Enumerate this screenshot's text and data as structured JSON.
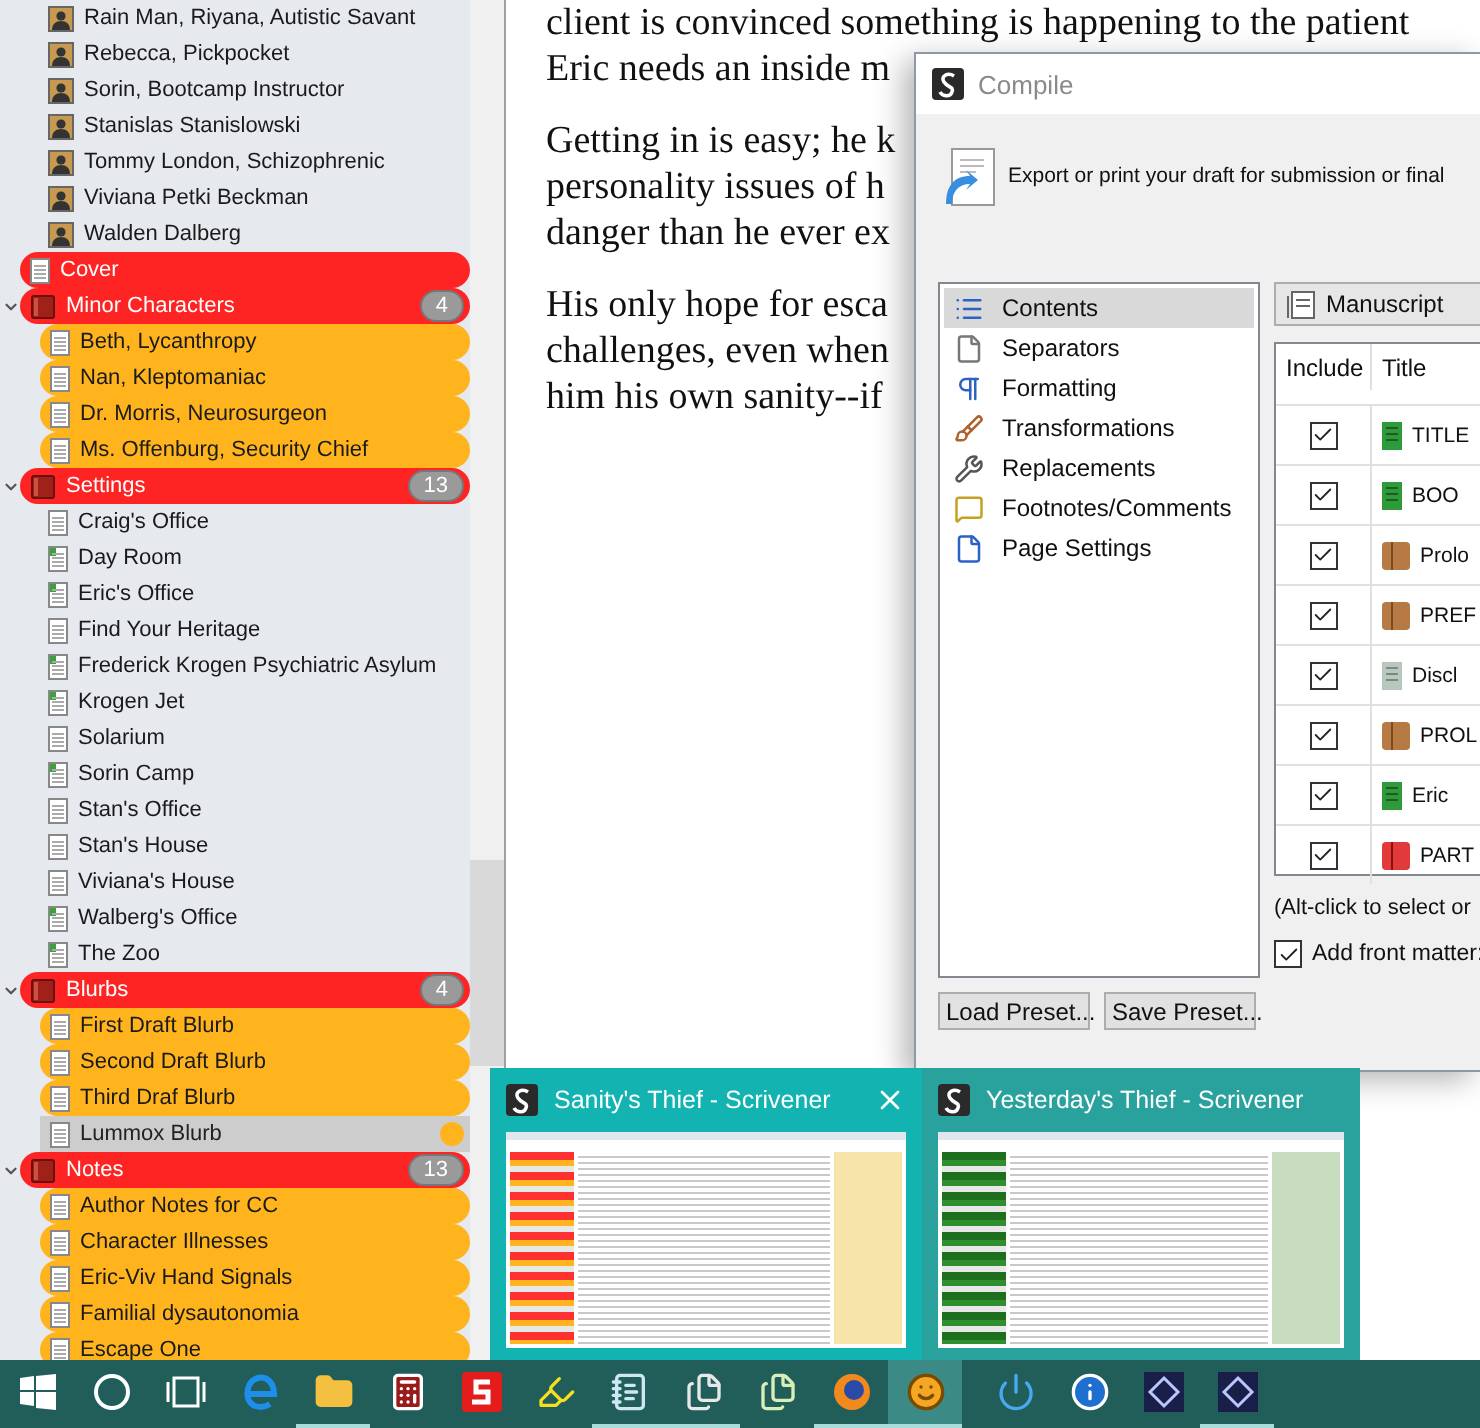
{
  "binder": {
    "continued_children": [
      {
        "label": "Rain Man, Riyana, Autistic Savant",
        "kind": "character",
        "selected": false
      },
      {
        "label": "Rebecca, Pickpocket",
        "kind": "character",
        "selected": false
      },
      {
        "label": "Sorin, Bootcamp Instructor",
        "kind": "character",
        "selected": false
      },
      {
        "label": "Stanislas Stanislowski",
        "kind": "character",
        "selected": false
      },
      {
        "label": "Tommy London, Schizophrenic",
        "kind": "character",
        "selected": false
      },
      {
        "label": "Viviana Petki Beckman",
        "kind": "character",
        "selected": false
      },
      {
        "label": "Walden Dalberg",
        "kind": "character",
        "selected": false
      }
    ],
    "items": [
      {
        "label": "Cover",
        "kind": "document",
        "color": "#ff2424",
        "selected": false
      },
      {
        "label": "Minor Characters",
        "kind": "folder",
        "color": "#ff2424",
        "expanded": true,
        "count": "4",
        "selected": false,
        "children": [
          {
            "label": "Beth, Lycanthropy",
            "kind": "document",
            "color": "#ffb41e",
            "selected": false
          },
          {
            "label": "Nan, Kleptomaniac",
            "kind": "document",
            "color": "#ffb41e",
            "selected": false
          },
          {
            "label": "Dr. Morris, Neurosurgeon",
            "kind": "document",
            "color": "#ffb41e",
            "selected": false
          },
          {
            "label": "Ms. Offenburg, Security Chief",
            "kind": "document",
            "color": "#ffb41e",
            "selected": false
          }
        ]
      },
      {
        "label": "Settings",
        "kind": "folder",
        "color": "#ff2424",
        "expanded": true,
        "count": "13",
        "selected": false,
        "children": [
          {
            "label": "Craig's Office",
            "kind": "document",
            "selected": false
          },
          {
            "label": "Day Room",
            "kind": "scene",
            "selected": false
          },
          {
            "label": "Eric's Office",
            "kind": "scene",
            "selected": false
          },
          {
            "label": "Find Your Heritage",
            "kind": "document",
            "selected": false
          },
          {
            "label": "Frederick Krogen Psychiatric Asylum",
            "kind": "scene",
            "selected": false
          },
          {
            "label": "Krogen Jet",
            "kind": "scene",
            "selected": false
          },
          {
            "label": "Solarium",
            "kind": "document",
            "selected": false
          },
          {
            "label": "Sorin Camp",
            "kind": "scene",
            "selected": false
          },
          {
            "label": "Stan's Office",
            "kind": "document",
            "selected": false
          },
          {
            "label": "Stan's House",
            "kind": "document",
            "selected": false
          },
          {
            "label": "Viviana's House",
            "kind": "document",
            "selected": false
          },
          {
            "label": "Walberg's Office",
            "kind": "scene",
            "selected": false
          },
          {
            "label": "The Zoo",
            "kind": "scene",
            "selected": false
          }
        ]
      },
      {
        "label": "Blurbs",
        "kind": "folder",
        "color": "#ff2424",
        "expanded": true,
        "count": "4",
        "selected": false,
        "children": [
          {
            "label": "First Draft Blurb",
            "kind": "document",
            "color": "#ffb41e",
            "selected": false
          },
          {
            "label": "Second Draft Blurb",
            "kind": "document",
            "color": "#ffb41e",
            "selected": false
          },
          {
            "label": "Third Draf Blurb",
            "kind": "document",
            "color": "#ffb41e",
            "selected": false
          },
          {
            "label": "Lummox Blurb",
            "kind": "document",
            "color": "#ffb41e",
            "selected": true
          }
        ]
      },
      {
        "label": "Notes",
        "kind": "folder",
        "color": "#ff2424",
        "expanded": true,
        "count": "13",
        "selected": false,
        "children": [
          {
            "label": "Author Notes for CC",
            "kind": "document",
            "color": "#ffb41e",
            "selected": false
          },
          {
            "label": "Character Illnesses",
            "kind": "document",
            "color": "#ffb41e",
            "selected": false
          },
          {
            "label": "Eric-Viv Hand Signals",
            "kind": "document",
            "color": "#ffb41e",
            "selected": false
          },
          {
            "label": "Familial dysautonomia",
            "kind": "document",
            "color": "#ffb41e",
            "selected": false
          },
          {
            "label": "Escape One",
            "kind": "document",
            "color": "#ffb41e",
            "selected": false
          }
        ]
      }
    ]
  },
  "editor": {
    "paragraphs": [
      [
        "client is convinced something is happening to the patient",
        "Eric needs an inside m"
      ],
      [
        "Getting in is easy; he k",
        "personality issues of h",
        "danger than he ever ex"
      ],
      [
        "His only hope for esca",
        "challenges, even when",
        "him his own sanity--if"
      ]
    ]
  },
  "compile": {
    "title": "Compile",
    "intro": "Export or print your draft for submission or final",
    "sections": [
      {
        "label": "Contents",
        "selected": true
      },
      {
        "label": "Separators",
        "selected": false
      },
      {
        "label": "Formatting",
        "selected": false
      },
      {
        "label": "Transformations",
        "selected": false
      },
      {
        "label": "Replacements",
        "selected": false
      },
      {
        "label": "Footnotes/Comments",
        "selected": false
      },
      {
        "label": "Page Settings",
        "selected": false
      }
    ],
    "buttons": [
      "Load Preset...",
      "Save Preset..."
    ],
    "format": "Manuscript",
    "table": {
      "columns": [
        "Include",
        "Title"
      ],
      "rows": [
        {
          "checked": true,
          "title": "TITLE",
          "kind": "scene"
        },
        {
          "checked": true,
          "title": "BOO",
          "kind": "scene"
        },
        {
          "checked": true,
          "title": "Prolo",
          "kind": "folder"
        },
        {
          "checked": true,
          "title": "PREF",
          "kind": "folder"
        },
        {
          "checked": true,
          "title": "Discl",
          "kind": "document"
        },
        {
          "checked": true,
          "title": "PROL",
          "kind": "folder"
        },
        {
          "checked": true,
          "title": "Eric",
          "kind": "scene"
        },
        {
          "checked": true,
          "title": "PART",
          "kind": "part"
        }
      ]
    },
    "hint": "(Alt-click to select or",
    "front_matter": {
      "label": "Add front matter:",
      "checked": true
    }
  },
  "thumbnails": [
    {
      "title": "Sanity's Thief - Scrivener",
      "selected": true
    },
    {
      "title": "Yesterday's Thief - Scrivener",
      "selected": false
    }
  ],
  "taskbar": {
    "buttons": [
      {
        "running": false,
        "selected": false
      },
      {
        "running": false,
        "selected": false
      },
      {
        "running": false,
        "selected": false
      },
      {
        "running": false,
        "selected": false
      },
      {
        "running": true,
        "selected": false
      },
      {
        "running": false,
        "selected": false
      },
      {
        "running": false,
        "selected": false
      },
      {
        "running": false,
        "selected": false
      },
      {
        "running": true,
        "selected": false
      },
      {
        "running": true,
        "selected": false
      },
      {
        "running": false,
        "selected": false
      },
      {
        "running": true,
        "selected": false
      },
      {
        "running": true,
        "selected": true
      },
      {
        "running": false,
        "selected": false
      },
      {
        "running": false,
        "selected": false
      },
      {
        "running": false,
        "selected": false
      },
      {
        "running": true,
        "selected": false
      }
    ]
  }
}
